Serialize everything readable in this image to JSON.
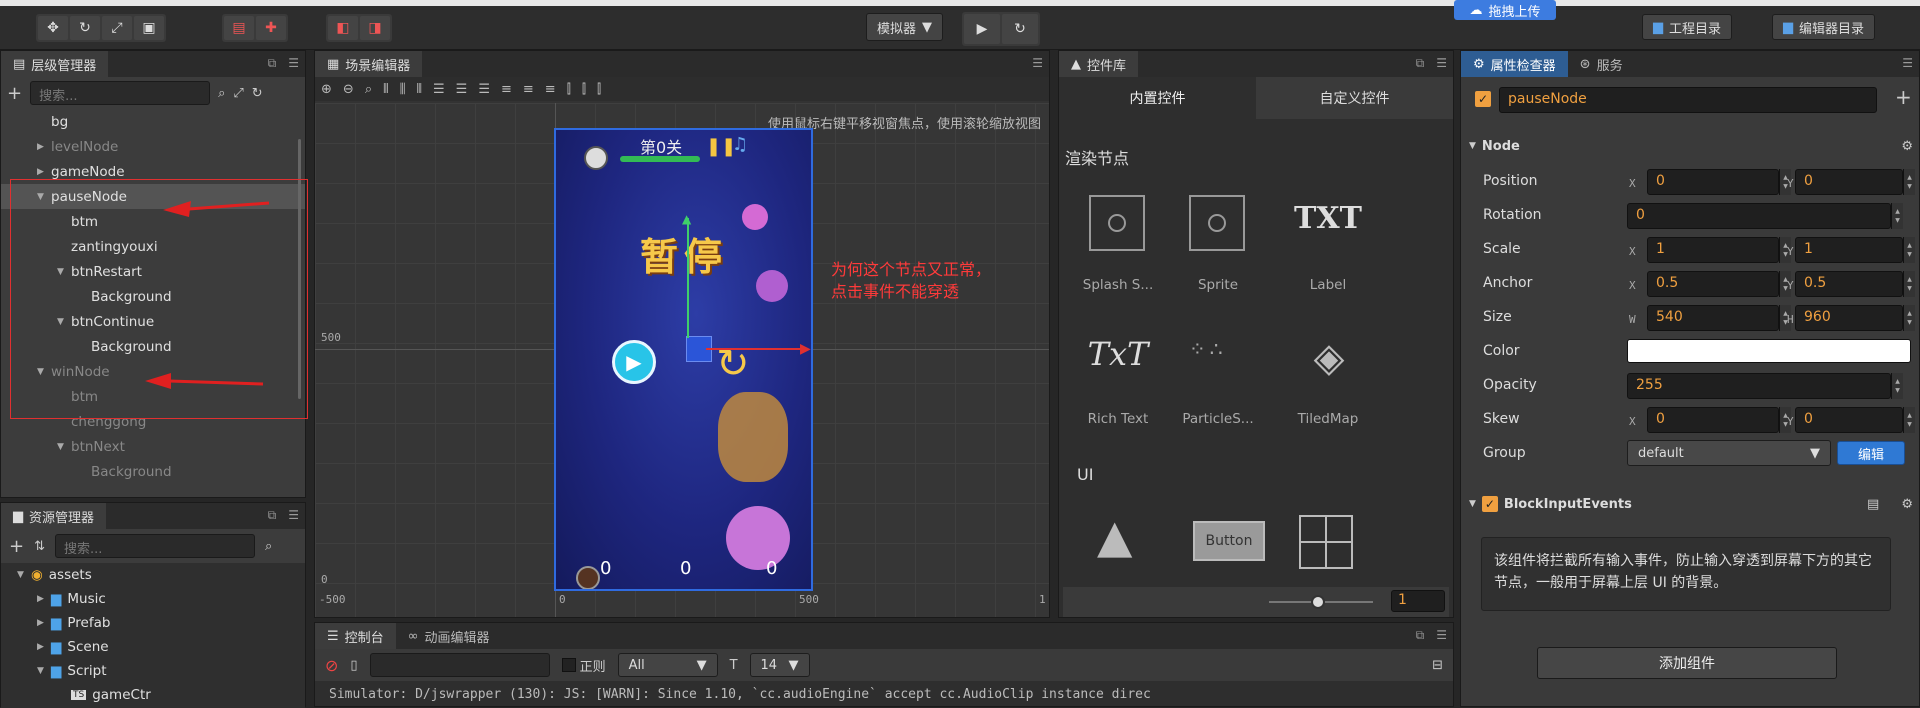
{
  "toolbar": {
    "simulator_label": "模拟器",
    "upload_label": "拖拽上传",
    "project_label": "工程目录",
    "editor_label": "编辑器目录"
  },
  "hierarchy": {
    "title": "层级管理器",
    "search_placeholder": "搜索...",
    "nodes": [
      {
        "label": "bg",
        "indent": 1,
        "arrow": "",
        "dim": false,
        "sel": false
      },
      {
        "label": "levelNode",
        "indent": 1,
        "arrow": "right",
        "dim": true,
        "sel": false
      },
      {
        "label": "gameNode",
        "indent": 1,
        "arrow": "right",
        "dim": false,
        "sel": false
      },
      {
        "label": "pauseNode",
        "indent": 1,
        "arrow": "down",
        "dim": false,
        "sel": true
      },
      {
        "label": "btm",
        "indent": 2,
        "arrow": "",
        "dim": false,
        "sel": false
      },
      {
        "label": "zantingyouxi",
        "indent": 2,
        "arrow": "",
        "dim": false,
        "sel": false
      },
      {
        "label": "btnRestart",
        "indent": 2,
        "arrow": "down",
        "dim": false,
        "sel": false
      },
      {
        "label": "Background",
        "indent": 3,
        "arrow": "",
        "dim": false,
        "sel": false
      },
      {
        "label": "btnContinue",
        "indent": 2,
        "arrow": "down",
        "dim": false,
        "sel": false
      },
      {
        "label": "Background",
        "indent": 3,
        "arrow": "",
        "dim": false,
        "sel": false
      },
      {
        "label": "winNode",
        "indent": 1,
        "arrow": "down",
        "dim": true,
        "sel": false
      },
      {
        "label": "btm",
        "indent": 2,
        "arrow": "",
        "dim": true,
        "sel": false
      },
      {
        "label": "chenggong",
        "indent": 2,
        "arrow": "",
        "dim": true,
        "sel": false
      },
      {
        "label": "btnNext",
        "indent": 2,
        "arrow": "down",
        "dim": true,
        "sel": false
      },
      {
        "label": "Background",
        "indent": 3,
        "arrow": "",
        "dim": true,
        "sel": false
      }
    ]
  },
  "assets": {
    "title": "资源管理器",
    "search_placeholder": "搜索...",
    "items": [
      {
        "label": "assets",
        "indent": 0,
        "arrow": "down",
        "icon": "assets"
      },
      {
        "label": "Music",
        "indent": 1,
        "arrow": "right",
        "icon": "folder"
      },
      {
        "label": "Prefab",
        "indent": 1,
        "arrow": "right",
        "icon": "folder"
      },
      {
        "label": "Scene",
        "indent": 1,
        "arrow": "right",
        "icon": "folder"
      },
      {
        "label": "Script",
        "indent": 1,
        "arrow": "down",
        "icon": "folder"
      },
      {
        "label": "gameCtr",
        "indent": 2,
        "arrow": "",
        "icon": "ts"
      }
    ]
  },
  "scene": {
    "title": "场景编辑器",
    "hint": "使用鼠标右键平移视窗焦点，使用滚轮缩放视图",
    "y_label_500": "500",
    "y_label_0": "0",
    "x_labels": [
      "-500",
      "0",
      "500",
      "1"
    ],
    "game": {
      "level": "第0关",
      "pause_text": "暂停",
      "score_left": "0",
      "score_mid": "0",
      "score_right": "0"
    },
    "annotation": "为何这个节点又正常，\n点击事件不能穿透"
  },
  "console": {
    "title": "控制台",
    "anim_title": "动画编辑器",
    "regex_label": "正则",
    "level": "All",
    "font_size": "14",
    "log": "Simulator: D/jswrapper (130): JS: [WARN]: Since 1.10, `cc.audioEngine` accept cc.AudioClip instance direc"
  },
  "widgets": {
    "title": "控件库",
    "tab_builtin": "内置控件",
    "tab_custom": "自定义控件",
    "section_render": "渲染节点",
    "section_ui": "UI",
    "render_items": [
      "Splash S...",
      "Sprite",
      "Label",
      "Rich Text",
      "ParticleS...",
      "TiledMap"
    ],
    "label_icon_text": "TXT",
    "richtext_icon_text": "TxT",
    "button_icon_text": "Button",
    "zoom_value": "1"
  },
  "inspector": {
    "title": "属性检查器",
    "service_title": "服务",
    "node_name": "pauseNode",
    "section_node": "Node",
    "position_label": "Position",
    "position_x": "0",
    "position_y": "0",
    "rotation_label": "Rotation",
    "rotation": "0",
    "scale_label": "Scale",
    "scale_x": "1",
    "scale_y": "1",
    "anchor_label": "Anchor",
    "anchor_x": "0.5",
    "anchor_y": "0.5",
    "size_label": "Size",
    "size_w": "540",
    "size_h": "960",
    "color_label": "Color",
    "color_value": "#ffffff",
    "opacity_label": "Opacity",
    "opacity": "255",
    "skew_label": "Skew",
    "skew_x": "0",
    "skew_y": "0",
    "group_label": "Group",
    "group": "default",
    "edit_label": "编辑",
    "axis_x": "X",
    "axis_y": "Y",
    "axis_w": "W",
    "axis_h": "H",
    "block_title": "BlockInputEvents",
    "block_desc": "该组件将拦截所有输入事件，防止输入穿透到屏幕下方的其它节点，一般用于屏幕上层 UI 的背景。",
    "add_component": "添加组件"
  }
}
